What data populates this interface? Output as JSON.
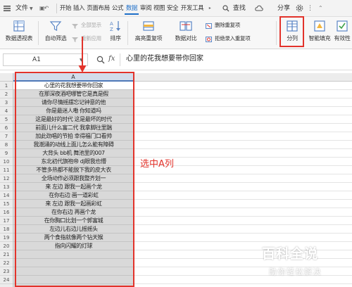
{
  "menubar": {
    "file_label": "文件",
    "tabs": [
      "开始",
      "插入",
      "页面布局",
      "公式",
      "数据",
      "审阅",
      "视图",
      "安全",
      "开发工具"
    ],
    "active_tab": "数据",
    "search_label": "查找",
    "share_label": "分享"
  },
  "ribbon": {
    "pivot_label": "数据透视表",
    "autofilter_label": "自动筛选",
    "show_all_label": "全部显示",
    "reapply_label": "重新应用",
    "sort_label": "排序",
    "highlight_dup_label": "高亮重复项",
    "compare_label": "数据对比",
    "delete_dup_label": "删除重复项",
    "reject_dup_label": "拒绝录入重复项",
    "split_label": "分列",
    "smart_fill_label": "智能填充",
    "validity_label": "有效性"
  },
  "formula_bar": {
    "cell_ref": "A1",
    "fx_label": "fx",
    "content": "心里的花我想要带你回家"
  },
  "sheet": {
    "column_a_header": "A",
    "row_numbers": [
      "1",
      "2",
      "3",
      "4",
      "5",
      "6",
      "7",
      "8",
      "9",
      "10",
      "11",
      "12",
      "13",
      "14",
      "15",
      "16",
      "17",
      "18",
      "19",
      "20",
      "21",
      "22",
      "23",
      "24"
    ],
    "column_a": [
      "心里的花我想要带你回家",
      "在那深夜酒吧哪管它是真是假",
      "请你尽情摇摆忘记钟意的他",
      "你是最迷人嘞 你知道吗",
      "这是最好的时代 这是最坏的时代",
      "前面儿什么富二代 我拿脚往里踹",
      "加此劲唱的节拍 幸得福门口看帅",
      "我潮涌的动线上面儿怎么能有障碍",
      "大背头 bb机 舞池里的007",
      "东北初代旗袍帝 dj眼我也懵",
      "不管多热都不能脱下我的皮大衣",
      "全场动作必须跟我整齐划一",
      "来 左边 跟我一起画个龙",
      "在你右边 画一道彩虹",
      "来 左边 跟我一起画彩虹",
      "在你右边 再画个龙",
      "在你胸口比划一个郭富城",
      "左边儿右边儿摇摇头",
      "两个食指就像两个钻天猴",
      "指向闪耀的灯球",
      "",
      "",
      "",
      ""
    ]
  },
  "annotation": {
    "label": "选中A列",
    "color": "#e2332b"
  },
  "watermark": {
    "main": "百科全说",
    "sub": "助你轻松解决"
  },
  "colors": {
    "accent_blue": "#1e6fc8",
    "highlight_red": "#e2332b",
    "selected_column_fill": "#d9d9d9"
  }
}
